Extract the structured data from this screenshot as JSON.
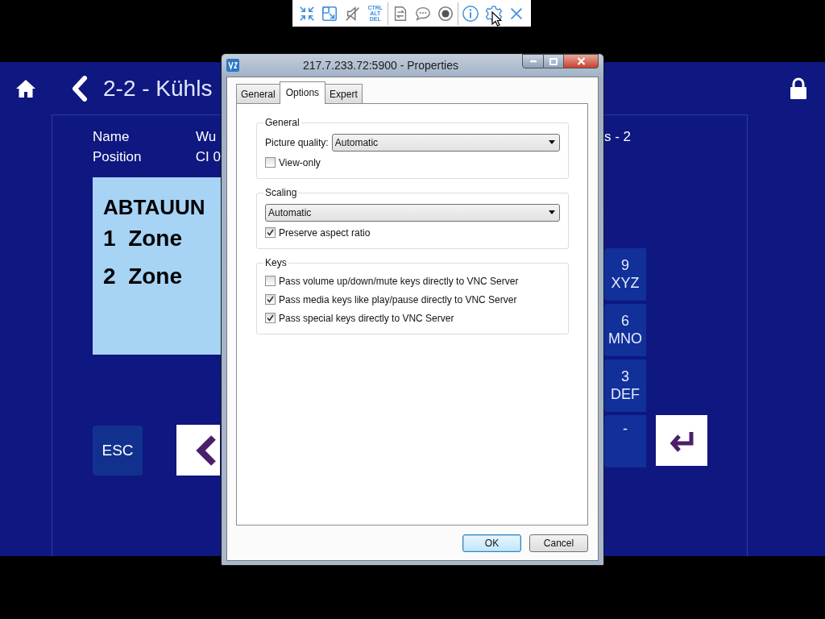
{
  "toolbar": {
    "items": [
      {
        "kind": "shrink"
      },
      {
        "kind": "scale"
      },
      {
        "kind": "mute"
      },
      {
        "kind": "keys",
        "lines": [
          "CTRL",
          "ALT",
          "DEL"
        ]
      },
      {
        "kind": "transfer"
      },
      {
        "kind": "chat"
      },
      {
        "kind": "record"
      },
      {
        "kind": "info"
      },
      {
        "kind": "settings",
        "hovered": true
      },
      {
        "kind": "close"
      }
    ]
  },
  "app": {
    "title": "2-2 - Kühls",
    "fields": [
      {
        "label": "Name",
        "value": "Wu"
      },
      {
        "label": "Position",
        "value": "CI 0"
      }
    ],
    "field_right": "s - 2",
    "display": {
      "heading": "ABTAUUN",
      "lines": [
        "1  Zone",
        "2  Zone"
      ]
    },
    "esc": "ESC",
    "keys": [
      {
        "digit": "9",
        "letters": "XYZ"
      },
      {
        "digit": "6",
        "letters": "MNO"
      },
      {
        "digit": "3",
        "letters": "DEF"
      },
      {
        "digit": "-"
      }
    ]
  },
  "dialog": {
    "title": "217.7.233.72:5900 - Properties",
    "tabs": [
      {
        "label": "General",
        "selected": false
      },
      {
        "label": "Options",
        "selected": true
      },
      {
        "label": "Expert",
        "selected": false
      }
    ],
    "groups": [
      {
        "title": "General",
        "items": [
          {
            "kind": "select",
            "label": "Picture quality:",
            "value": "Automatic"
          },
          {
            "kind": "checkbox",
            "label": "View-only",
            "checked": false
          }
        ]
      },
      {
        "title": "Scaling",
        "items": [
          {
            "kind": "select",
            "value": "Automatic"
          },
          {
            "kind": "checkbox",
            "label": "Preserve aspect ratio",
            "checked": true
          }
        ]
      },
      {
        "title": "Keys",
        "items": [
          {
            "kind": "checkbox",
            "label": "Pass volume up/down/mute keys directly to VNC Server",
            "checked": false
          },
          {
            "kind": "checkbox",
            "label": "Pass media keys like play/pause directly to VNC Server",
            "checked": true
          },
          {
            "kind": "checkbox",
            "label": "Pass special keys directly to VNC Server",
            "checked": true
          }
        ]
      }
    ],
    "buttons": [
      {
        "label": "OK",
        "default": true
      },
      {
        "label": "Cancel",
        "default": false
      }
    ]
  }
}
